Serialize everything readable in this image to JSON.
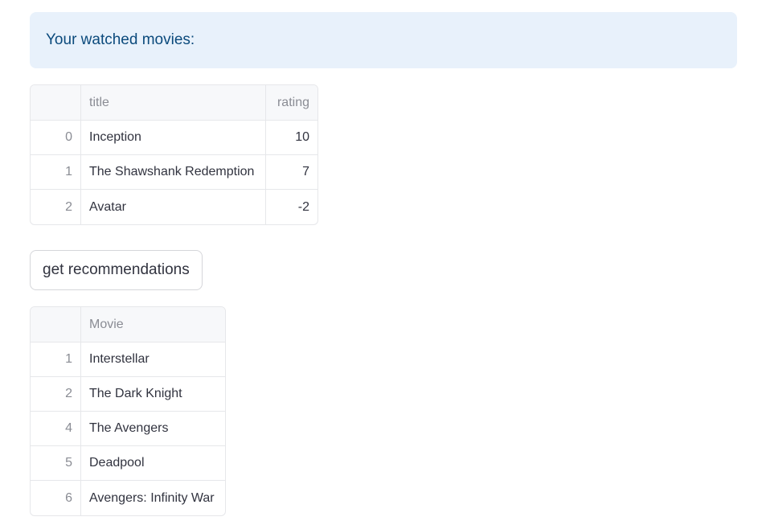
{
  "info": {
    "text": "Your watched movies:"
  },
  "watched_table": {
    "columns": [
      "title",
      "rating"
    ],
    "rows": [
      {
        "index": "0",
        "title": "Inception",
        "rating": "10"
      },
      {
        "index": "1",
        "title": "The Shawshank Redemption",
        "rating": "7"
      },
      {
        "index": "2",
        "title": "Avatar",
        "rating": "-2"
      }
    ]
  },
  "button": {
    "label": "get recommendations"
  },
  "recommendations_table": {
    "columns": [
      "Movie"
    ],
    "rows": [
      {
        "index": "1",
        "movie": "Interstellar"
      },
      {
        "index": "2",
        "movie": "The Dark Knight"
      },
      {
        "index": "4",
        "movie": "The Avengers"
      },
      {
        "index": "5",
        "movie": "Deadpool"
      },
      {
        "index": "6",
        "movie": "Avengers: Infinity War"
      }
    ]
  },
  "colors": {
    "info_bg": "#e8f1fb",
    "info_text": "#0b4a7c",
    "header_bg": "#f7f8fa"
  }
}
